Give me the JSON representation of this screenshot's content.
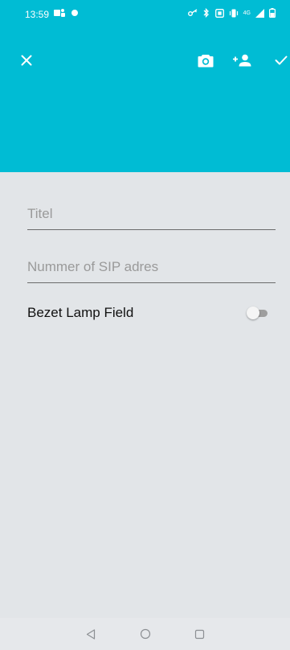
{
  "status_bar": {
    "time": "13:59",
    "signal_label": "4G"
  },
  "colors": {
    "header": "#00bcd4",
    "background": "#e2e5e8",
    "navbar": "#e6e8eb"
  },
  "toolbar": {
    "icons": [
      "close-icon",
      "camera-icon",
      "add-person-icon",
      "check-icon"
    ]
  },
  "form": {
    "title_placeholder": "Titel",
    "number_placeholder": "Nummer of SIP adres",
    "title_value": "",
    "number_value": "",
    "toggle_label": "Bezet Lamp Field",
    "toggle_on": false
  },
  "navbar": {
    "icons": [
      "back-icon",
      "home-icon",
      "recents-icon"
    ]
  }
}
